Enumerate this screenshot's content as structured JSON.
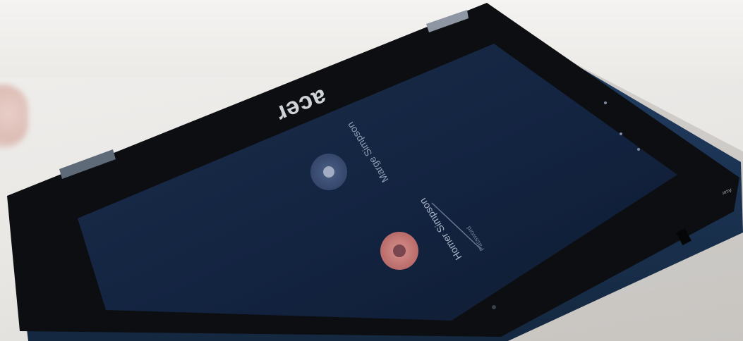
{
  "scene": {
    "description_free": true,
    "colors": {
      "table": "#e9e7e4",
      "bezel": "#0d0f12",
      "screen": "#16233b",
      "chassis_edge": "#1f3a5e",
      "avatar_primary": "#c87d7a",
      "avatar_secondary": "#3d4f74"
    }
  },
  "laptop": {
    "brand": "acer"
  },
  "login_screen": {
    "primary_user": "Homer Simpson",
    "secondary_user": "Marge Simpson",
    "password_placeholder": "Password"
  },
  "bezel_labels": {
    "bottom_right": "Acer"
  }
}
